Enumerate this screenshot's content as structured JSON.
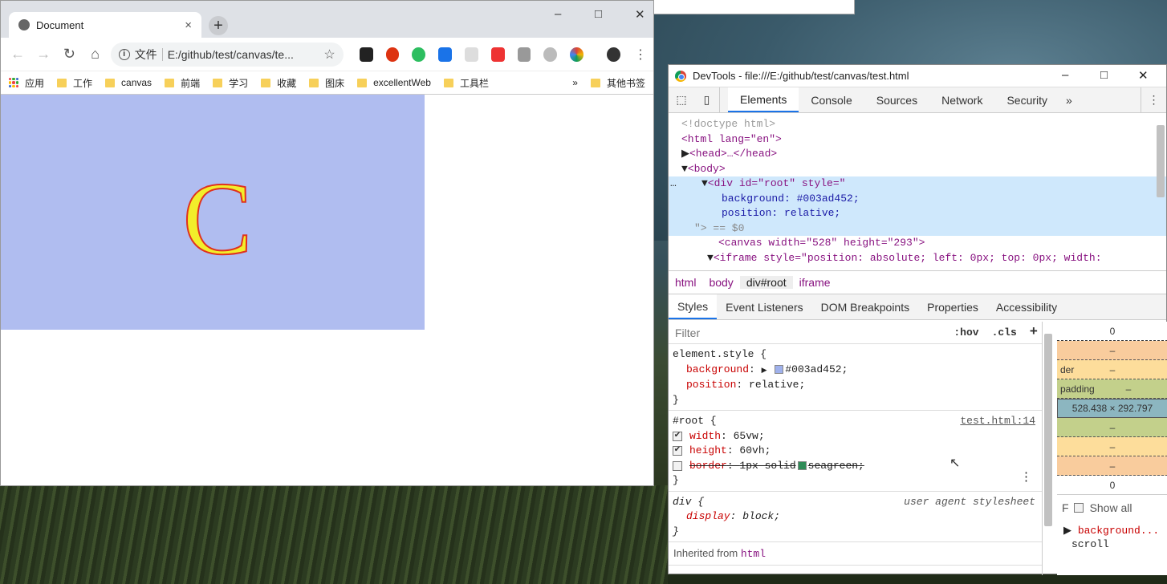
{
  "browser": {
    "tab_title": "Document",
    "tab_close": "×",
    "new_tab": "+",
    "url_scheme_label": "文件",
    "url": "E:/github/test/canvas/te...",
    "bookmarks": [
      "应用",
      "工作",
      "canvas",
      "前端",
      "学习",
      "收藏",
      "图床",
      "excellentWeb",
      "工具栏"
    ],
    "bookmarks_overflow": "»",
    "other_bookmarks": "其他书签"
  },
  "page": {
    "root_background": "#003ad452",
    "glyph": "C",
    "glyph_fill": "#f2ee2a",
    "glyph_stroke": "#e0321e"
  },
  "devtools": {
    "title": "DevTools - file:///E:/github/test/canvas/test.html",
    "tabs": [
      "Elements",
      "Console",
      "Sources",
      "Network",
      "Security"
    ],
    "more_tabs": "»",
    "dom": {
      "doctype": "<!doctype html>",
      "html_open": "<html lang=\"en\">",
      "head": "<head>…</head>",
      "body_open": "<body>",
      "div_open": "<div id=\"root\" style=\"",
      "div_style1": "background: #003ad452;",
      "div_style2": "position: relative;",
      "div_close": "\"> == $0",
      "canvas": "<canvas width=\"528\" height=\"293\">",
      "iframe": "<iframe style=\"position: absolute; left: 0px; top: 0px; width:"
    },
    "breadcrumbs": [
      "html",
      "body",
      "div#root",
      "iframe"
    ],
    "sub_tabs": [
      "Styles",
      "Event Listeners",
      "DOM Breakpoints",
      "Properties",
      "Accessibility"
    ],
    "filter_placeholder": "Filter",
    "hov": ":hov",
    "cls": ".cls",
    "add": "+",
    "element_style": {
      "selector": "element.style {",
      "bg_name": "background",
      "bg_value": "#003ad452;",
      "pos_name": "position",
      "pos_value": "relative;",
      "close": "}"
    },
    "root_rule": {
      "selector": "#root {",
      "source": "test.html:14",
      "width_name": "width",
      "width_value": "65vw;",
      "height_name": "height",
      "height_value": "60vh;",
      "border_name": "border",
      "border_value": "1px solid",
      "border_color": "seagreen;",
      "close": "}"
    },
    "ua_rule": {
      "selector": "div {",
      "source": "user agent stylesheet",
      "display_name": "display",
      "display_value": "block;",
      "close": "}"
    },
    "inherited_label": "Inherited from",
    "inherited_tag": "html",
    "box_model": {
      "top": "0",
      "bottom": "0",
      "border_label": "der",
      "padding_label": "padding",
      "dash": "–",
      "content": "528.438 × 292.797",
      "show_all": "Show all",
      "filter_short": "F",
      "computed_prop": "background...",
      "computed_val": "scroll"
    }
  }
}
